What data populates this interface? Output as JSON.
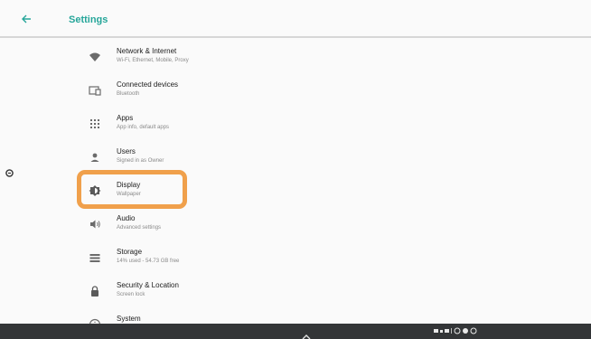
{
  "appbar": {
    "title": "Settings"
  },
  "settings": [
    {
      "title": "Network & Internet",
      "subtitle": "Wi-Fi, Ethernet, Mobile, Proxy",
      "icon": "wifi-icon"
    },
    {
      "title": "Connected devices",
      "subtitle": "Bluetooth",
      "icon": "devices-icon"
    },
    {
      "title": "Apps",
      "subtitle": "App info, default apps",
      "icon": "apps-icon"
    },
    {
      "title": "Users",
      "subtitle": "Signed in as Owner",
      "icon": "user-icon"
    },
    {
      "title": "Display",
      "subtitle": "Wallpaper",
      "icon": "brightness-icon"
    },
    {
      "title": "Audio",
      "subtitle": "Advanced settings",
      "icon": "volume-icon"
    },
    {
      "title": "Storage",
      "subtitle": "14% used - 54.73 GB free",
      "icon": "storage-icon"
    },
    {
      "title": "Security & Location",
      "subtitle": "Screen lock",
      "icon": "lock-icon"
    },
    {
      "title": "System",
      "subtitle": "",
      "icon": "info-icon"
    }
  ],
  "colors": {
    "accent": "#26a69a",
    "highlight": "#f0a04b",
    "navbar": "#333537"
  }
}
